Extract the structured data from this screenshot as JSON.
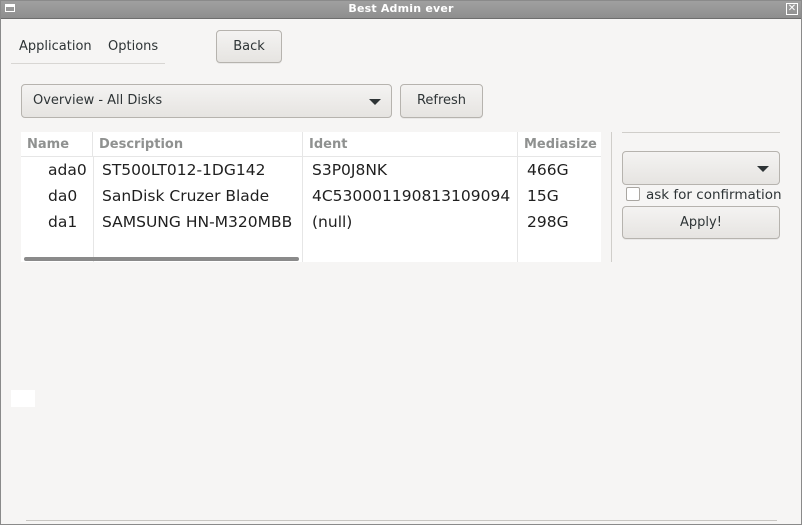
{
  "window": {
    "title": "Best Admin ever",
    "close_glyph": "✕"
  },
  "menubar": {
    "items": [
      {
        "label": "Application"
      },
      {
        "label": "Options"
      }
    ]
  },
  "toolbar": {
    "back_label": "Back",
    "refresh_label": "Refresh"
  },
  "view_select": {
    "value": "Overview - All Disks"
  },
  "table": {
    "columns": [
      "Name",
      "Description",
      "Ident",
      "Mediasize"
    ],
    "rows": [
      [
        "ada0",
        "ST500LT012-1DG142",
        "S3P0J8NK",
        "466G"
      ],
      [
        "da0",
        "SanDisk Cruzer Blade",
        "4C530001190813109094",
        "15G"
      ],
      [
        "da1",
        "SAMSUNG HN-M320MBB",
        "(null)",
        "298G"
      ]
    ]
  },
  "side_panel": {
    "action_select": {
      "value": ""
    },
    "confirm_checkbox": {
      "label": "ask for confirmation",
      "checked": false
    },
    "apply_label": "Apply!"
  },
  "icons": [
    "window-menu-icon",
    "close-icon",
    "chevron-down-icon"
  ]
}
